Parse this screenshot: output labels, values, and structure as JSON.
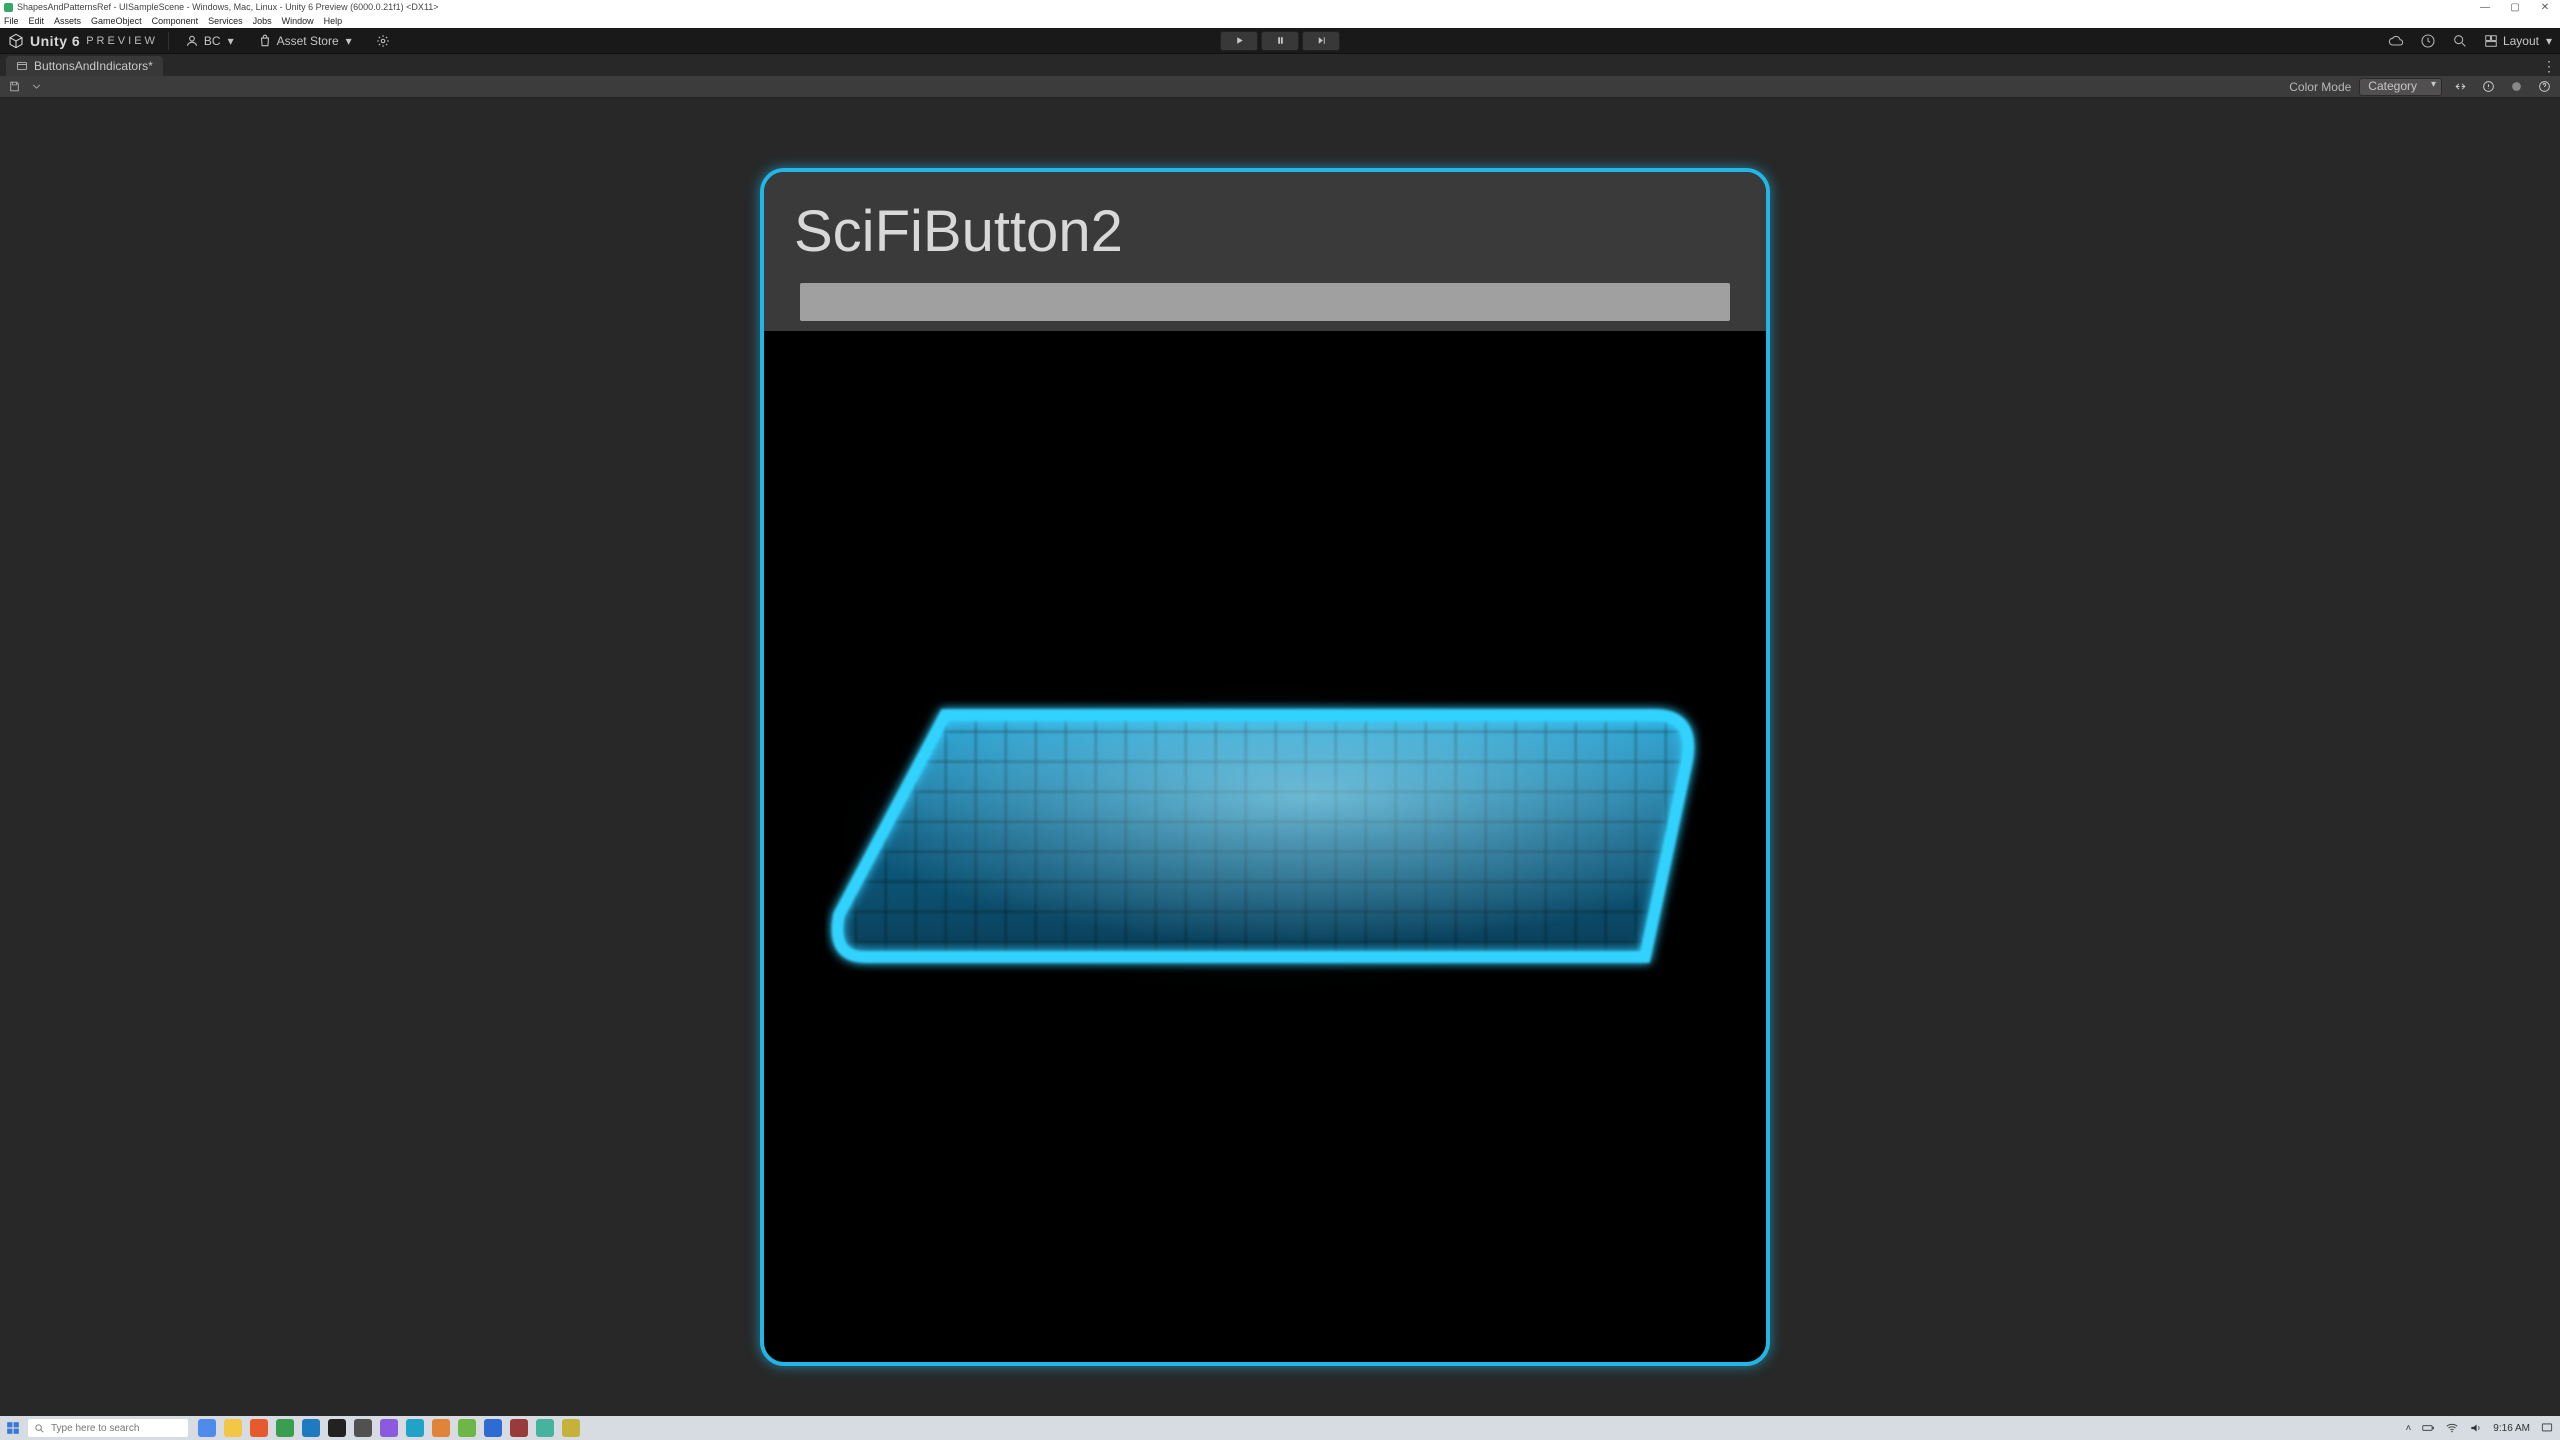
{
  "window": {
    "title": "ShapesAndPatternsRef - UISampleScene - Windows, Mac, Linux - Unity 6 Preview (6000.0.21f1) <DX11>"
  },
  "menubar": [
    "File",
    "Edit",
    "Assets",
    "GameObject",
    "Component",
    "Services",
    "Jobs",
    "Window",
    "Help"
  ],
  "toolbar": {
    "brand": "Unity 6",
    "brand_tag": "PREVIEW",
    "account_label": "BC",
    "asset_store_label": "Asset Store",
    "layout_label": "Layout"
  },
  "tab": {
    "title": "ButtonsAndIndicators*"
  },
  "graph_bar": {
    "color_mode_label": "Color Mode",
    "color_mode_value": "Category"
  },
  "node": {
    "title": "SciFiButton2"
  },
  "taskbar": {
    "search_placeholder": "Type here to search",
    "time": "9:16 AM",
    "app_colors": [
      "#4e8bed",
      "#f2c744",
      "#e65a2d",
      "#3a9d4f",
      "#1f7bbf",
      "#222",
      "#515151",
      "#8a5bdc",
      "#20a3c7",
      "#e0843a",
      "#6fb648",
      "#2f6bd4",
      "#9a3b3b",
      "#46b39d",
      "#c4b23a"
    ]
  }
}
